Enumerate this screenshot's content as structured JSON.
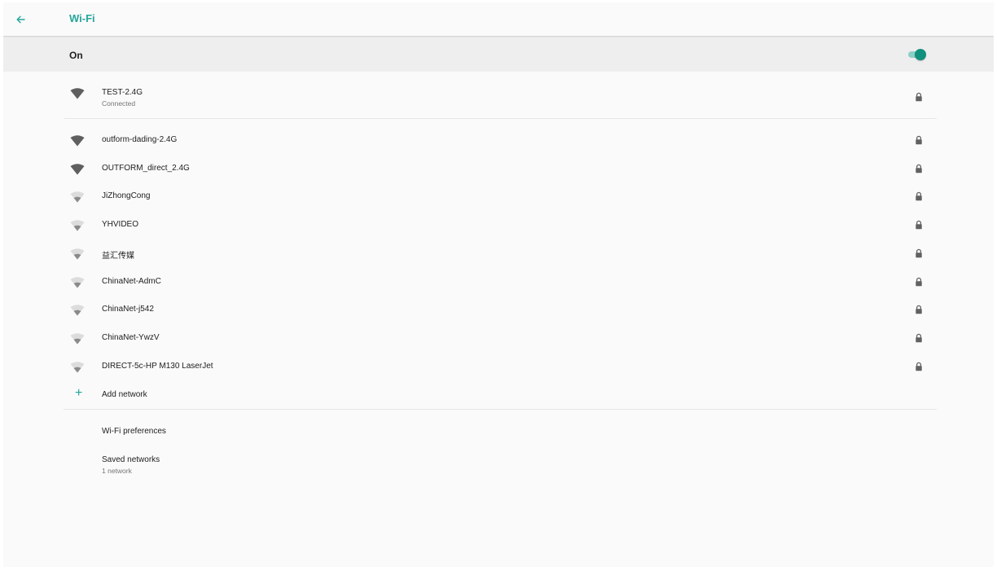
{
  "header": {
    "title": "Wi-Fi",
    "back_icon": "arrow-back-icon"
  },
  "master_switch": {
    "label": "On",
    "enabled": true,
    "accent_color": "#10907d"
  },
  "connected_network": {
    "ssid": "TEST-2.4G",
    "status": "Connected",
    "signal": "full",
    "secured": true
  },
  "networks": [
    {
      "ssid": "outform-dading-2.4G",
      "signal": "full",
      "secured": true
    },
    {
      "ssid": "OUTFORM_direct_2.4G",
      "signal": "full",
      "secured": true
    },
    {
      "ssid": "JiZhongCong",
      "signal": "weak",
      "secured": true
    },
    {
      "ssid": "YHVIDEO",
      "signal": "weak",
      "secured": true
    },
    {
      "ssid": "益汇传媒",
      "signal": "weak",
      "secured": true
    },
    {
      "ssid": "ChinaNet-AdmC",
      "signal": "weak",
      "secured": true
    },
    {
      "ssid": "ChinaNet-j542",
      "signal": "weak",
      "secured": true
    },
    {
      "ssid": "ChinaNet-YwzV",
      "signal": "weak",
      "secured": true
    },
    {
      "ssid": "DIRECT-5c-HP M130 LaserJet",
      "signal": "weak",
      "secured": true
    }
  ],
  "add_network": {
    "label": "Add network",
    "icon": "plus-icon"
  },
  "preferences": {
    "wifi_preferences": "Wi-Fi preferences",
    "saved_networks_title": "Saved networks",
    "saved_networks_summary": "1 network"
  }
}
